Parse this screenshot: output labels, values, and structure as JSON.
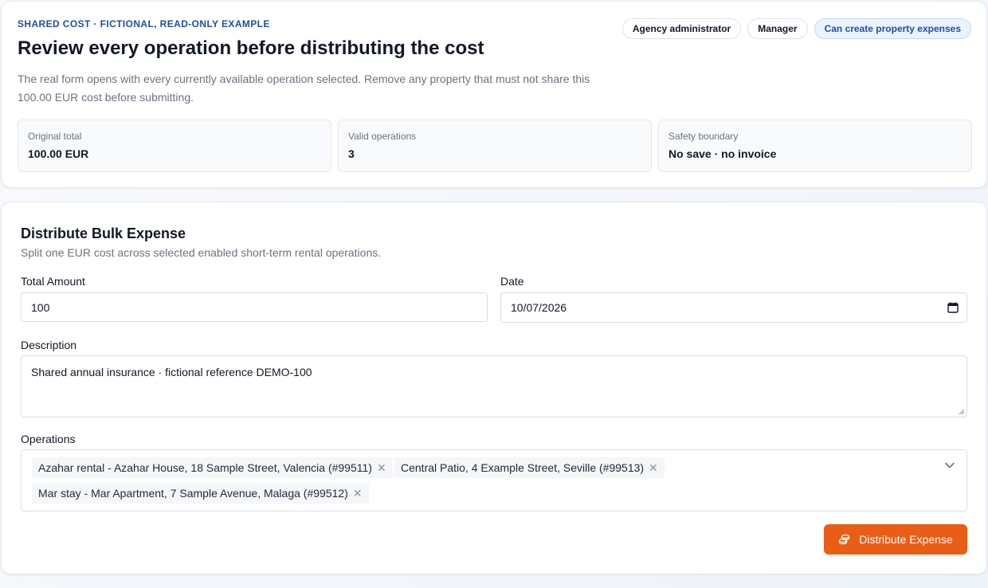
{
  "hero": {
    "eyebrow": "SHARED COST · FICTIONAL, READ-ONLY EXAMPLE",
    "title": "Review every operation before distributing the cost",
    "description": "The real form opens with every currently available operation selected. Remove any property that must not share this 100.00 EUR cost before submitting.",
    "roles": [
      "Agency administrator",
      "Manager",
      "Can create property expenses"
    ],
    "stats": [
      {
        "label": "Original total",
        "value": "100.00 EUR"
      },
      {
        "label": "Valid operations",
        "value": "3"
      },
      {
        "label": "Safety boundary",
        "value": "No save · no invoice"
      }
    ]
  },
  "form": {
    "title": "Distribute Bulk Expense",
    "subtitle": "Split one EUR cost across selected enabled short-term rental operations.",
    "total_amount_label": "Total Amount",
    "total_amount_value": "100",
    "date_label": "Date",
    "date_value": "10/07/2026",
    "description_label": "Description",
    "description_value": "Shared annual insurance · fictional reference DEMO-100",
    "operations_label": "Operations",
    "operations": [
      "Azahar rental - Azahar House, 18 Sample Street, Valencia (#99511)",
      "Central Patio, 4 Example Street, Seville (#99513)",
      "Mar stay - Mar Apartment, 7 Sample Avenue, Malaga (#99512)"
    ],
    "remove_glyph": "✕",
    "submit_label": "Distribute Expense"
  },
  "colors": {
    "accent": "#ea5d16",
    "eyebrow": "#1e4f9e",
    "chip_accent_bg": "#eaf2fd"
  },
  "icons": [
    "calendar-icon",
    "close-icon",
    "chevron-down-icon",
    "coins-icon"
  ]
}
